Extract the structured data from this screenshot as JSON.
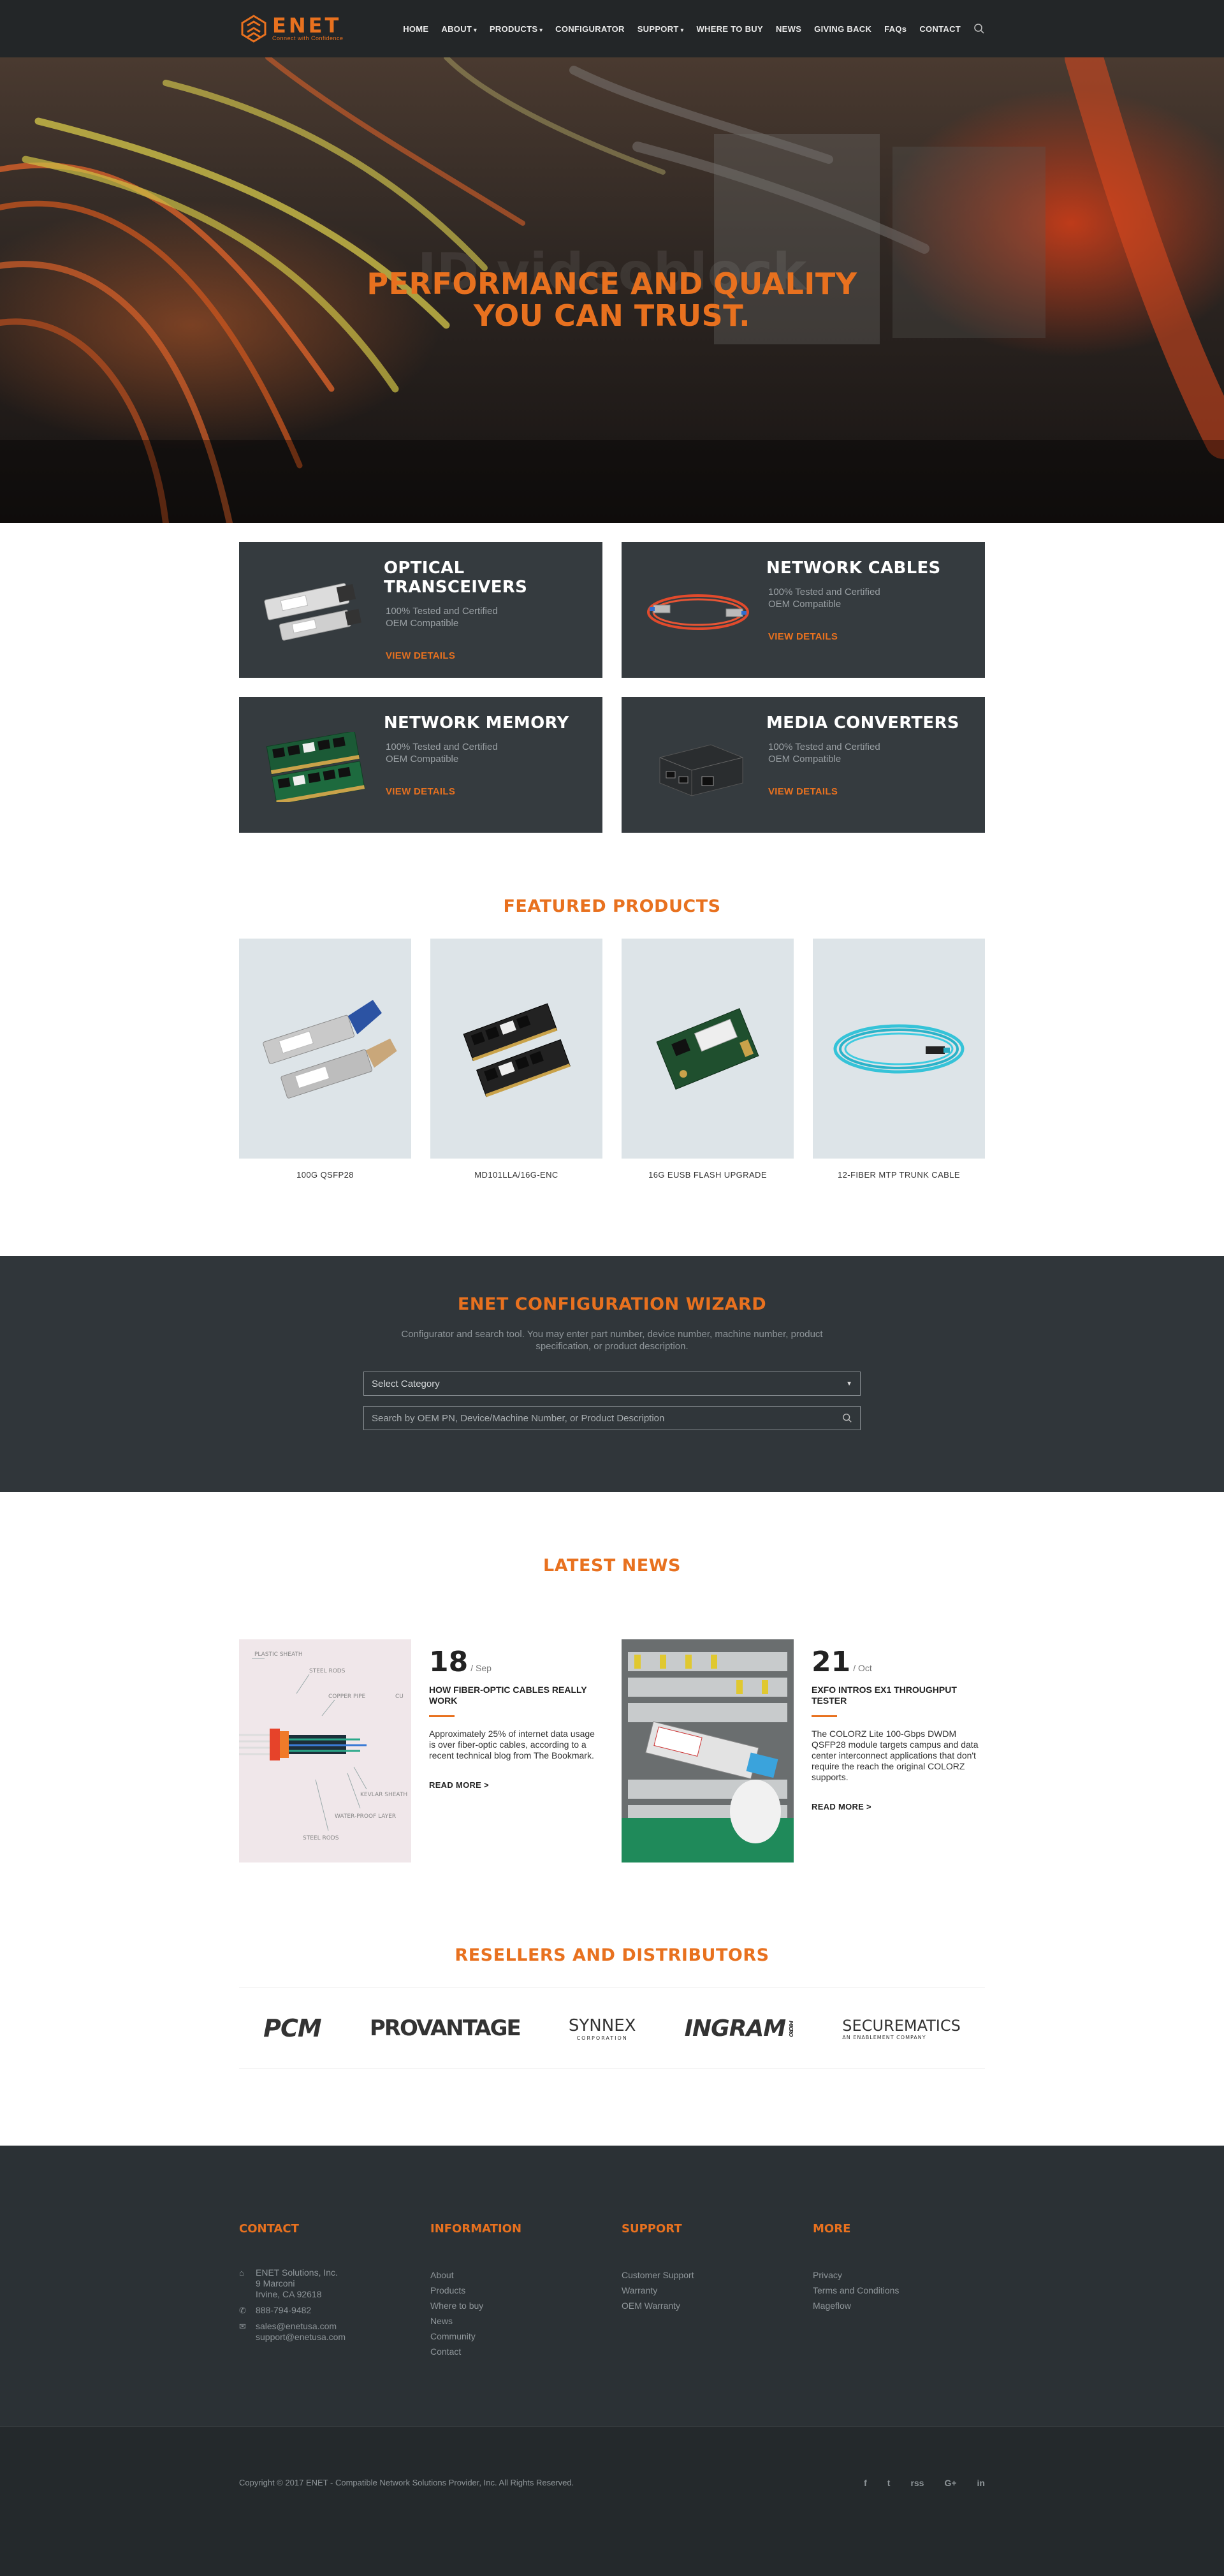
{
  "brand": {
    "name": "ENET",
    "tagline": "Connect with Confidence"
  },
  "colors": {
    "accent": "#e8711f",
    "dark_panel": "#353b3f",
    "header_bg": "#232628"
  },
  "nav": {
    "items": [
      {
        "label": "HOME",
        "has_caret": false
      },
      {
        "label": "ABOUT",
        "has_caret": true
      },
      {
        "label": "PRODUCTS",
        "has_caret": true
      },
      {
        "label": "CONFIGURATOR",
        "has_caret": false
      },
      {
        "label": "SUPPORT",
        "has_caret": true
      },
      {
        "label": "WHERE TO BUY",
        "has_caret": false
      },
      {
        "label": "NEWS",
        "has_caret": false
      },
      {
        "label": "GIVING BACK",
        "has_caret": false
      },
      {
        "label": "FAQs",
        "has_caret": false
      },
      {
        "label": "CONTACT",
        "has_caret": false
      }
    ],
    "search_icon": "search-icon"
  },
  "hero": {
    "ghost_text": "ID videoblock",
    "line1": "PERFORMANCE AND QUALITY",
    "line2": "YOU CAN TRUST."
  },
  "categories": [
    {
      "title": "OPTICAL TRANSCEIVERS",
      "line1": "100% Tested and Certified",
      "line2": "OEM Compatible",
      "cta": "VIEW DETAILS",
      "icon": "transceiver-image"
    },
    {
      "title": "NETWORK CABLES",
      "line1": "100% Tested and Certified",
      "line2": "OEM Compatible",
      "cta": "VIEW DETAILS",
      "icon": "cable-image"
    },
    {
      "title": "NETWORK MEMORY",
      "line1": "100% Tested and Certified",
      "line2": "OEM Compatible",
      "cta": "VIEW DETAILS",
      "icon": "memory-image"
    },
    {
      "title": "MEDIA CONVERTERS",
      "line1": "100% Tested and Certified",
      "line2": "OEM Compatible",
      "cta": "VIEW DETAILS",
      "icon": "converter-image"
    }
  ],
  "featured": {
    "title": "FEATURED PRODUCTS",
    "items": [
      {
        "name": "100G QSFP28"
      },
      {
        "name": "MD101LLA/16G-ENC"
      },
      {
        "name": "16G EUSB FLASH UPGRADE"
      },
      {
        "name": "12-FIBER MTP TRUNK CABLE"
      }
    ]
  },
  "wizard": {
    "title": "ENET CONFIGURATION WIZARD",
    "description": "Configurator and search tool. You may enter part number, device number, machine number, product specification, or product description.",
    "select_value": "Select Category",
    "search_placeholder": "Search by OEM PN, Device/Machine Number, or Product Description"
  },
  "news": {
    "title": "LATEST NEWS",
    "items": [
      {
        "day": "18",
        "month": "/ Sep",
        "headline": "HOW FIBER-OPTIC CABLES REALLY WORK",
        "text": "Approximately 25% of internet data usage is over fiber-optic cables, according to a recent technical blog from The Bookmark.",
        "more": "READ MORE >",
        "diagram_labels": [
          "PLASTIC SHEATH",
          "STEEL RODS",
          "COPPER PIPE",
          "CU",
          "KEVLAR SHEATH",
          "WATER-PROOF LAYER",
          "STEEL RODS"
        ]
      },
      {
        "day": "21",
        "month": "/ Oct",
        "headline": "EXFO INTROS EX1 THROUGHPUT TESTER",
        "text": "The COLORZ Lite 100-Gbps DWDM QSFP28 module targets campus and data center interconnect applications that don't require the reach the original COLORZ supports.",
        "more": "READ MORE >"
      }
    ]
  },
  "resellers": {
    "title": "RESELLERS AND DISTRIBUTORS",
    "logos": [
      {
        "name": "PCM",
        "sub": ""
      },
      {
        "name": "PROVANTAGE",
        "sub": ""
      },
      {
        "name": "SYNNEX",
        "sub": "CORPORATION"
      },
      {
        "name": "INGRAM",
        "sub": "MICRO"
      },
      {
        "name": "SECUREMATICS",
        "sub": "AN ENABLEMENT COMPANY"
      }
    ]
  },
  "footer": {
    "contact": {
      "title": "CONTACT",
      "address": [
        "ENET Solutions, Inc.",
        "9 Marconi",
        "Irvine, CA 92618"
      ],
      "phone": "888-794-9482",
      "emails": [
        "sales@enetusa.com",
        "support@enetusa.com"
      ]
    },
    "information": {
      "title": "INFORMATION",
      "links": [
        "About",
        "Products",
        "Where to buy",
        "News",
        "Community",
        "Contact"
      ]
    },
    "support": {
      "title": "SUPPORT",
      "links": [
        "Customer Support",
        "Warranty",
        "OEM Warranty"
      ]
    },
    "more": {
      "title": "MORE",
      "links": [
        "Privacy",
        "Terms and Conditions",
        "Mageflow"
      ]
    },
    "copyright": "Copyright © 2017 ENET - Compatible Network Solutions Provider, Inc. All Rights Reserved.",
    "social": [
      "f",
      "t",
      "rss",
      "G+",
      "in"
    ]
  }
}
